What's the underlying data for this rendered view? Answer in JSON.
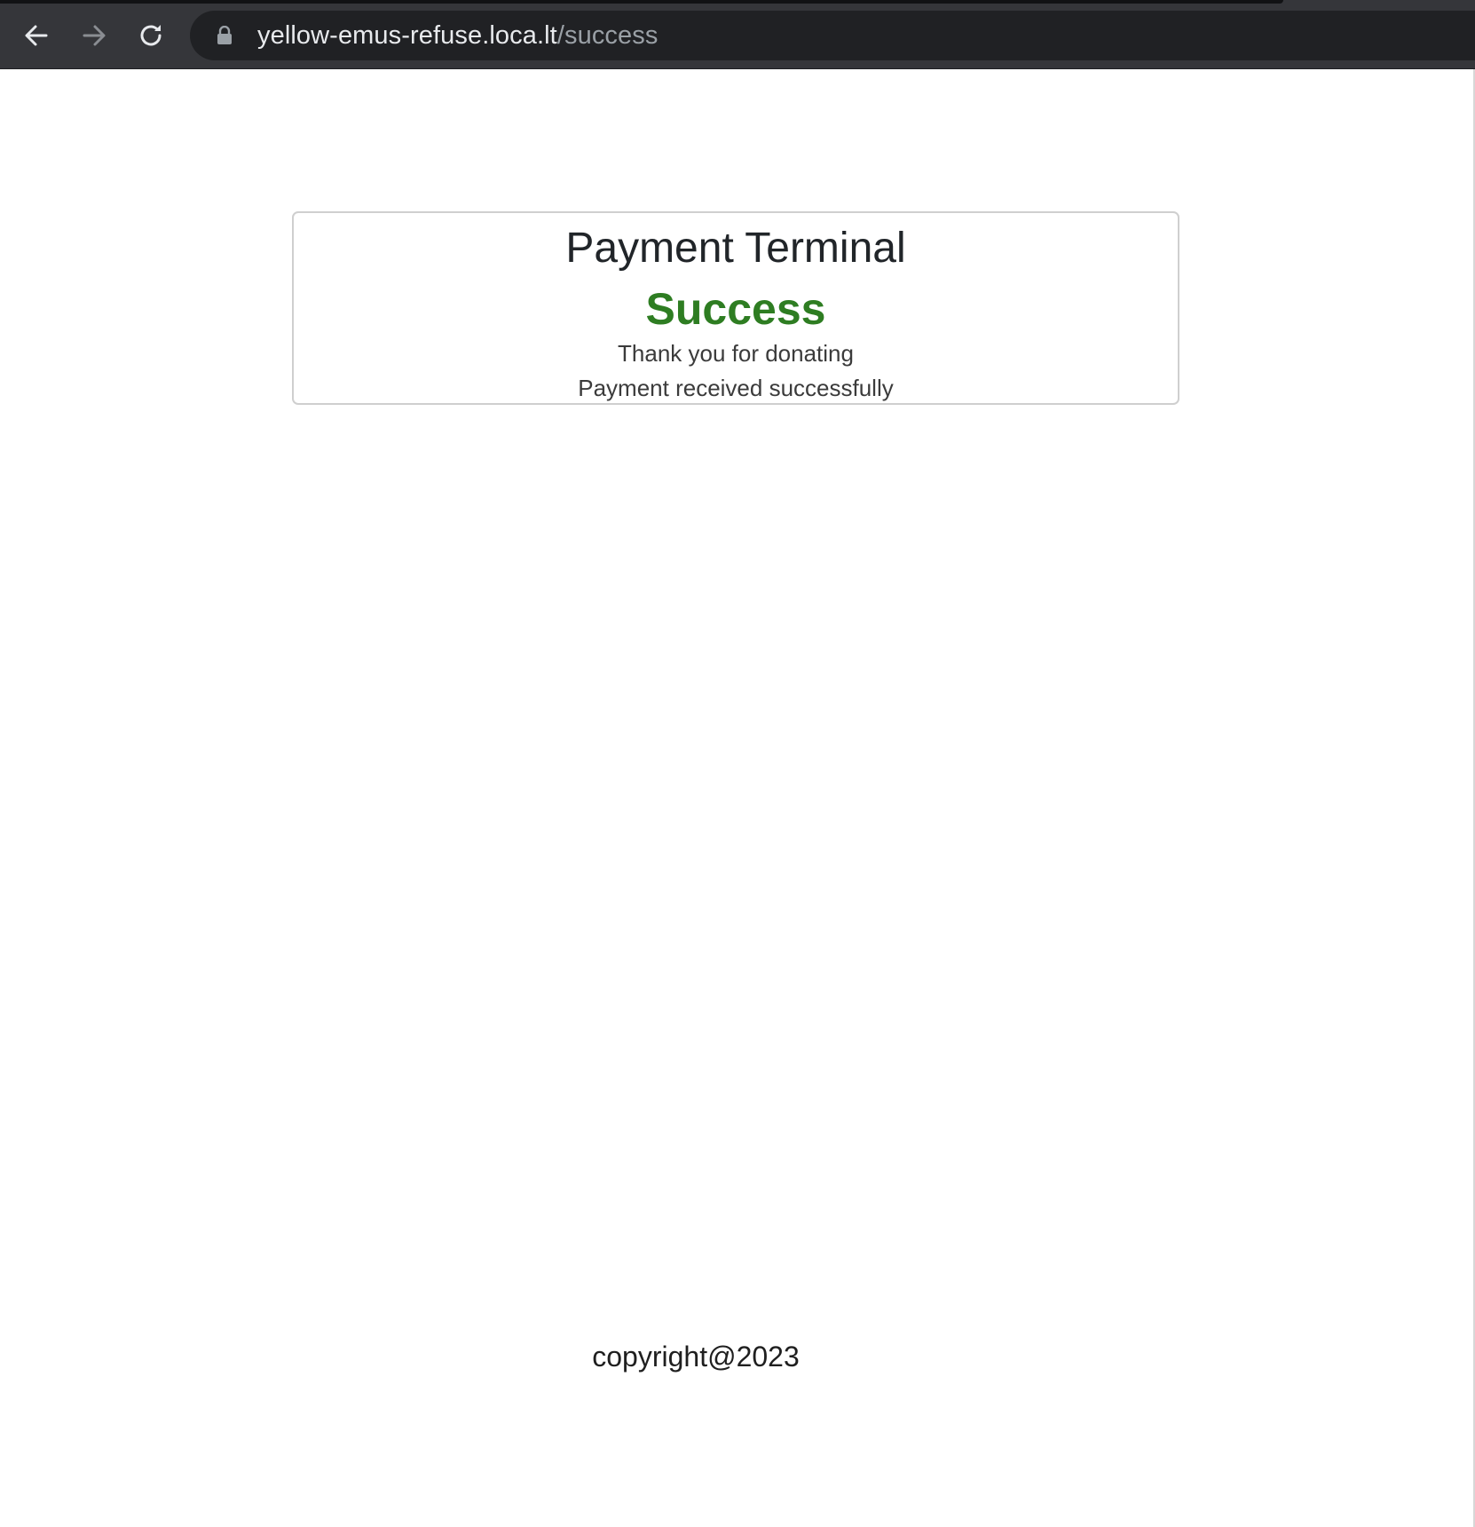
{
  "browser": {
    "url_host": "yellow-emus-refuse.loca.lt",
    "url_path": "/success",
    "icons": {
      "back": "back-arrow-icon",
      "forward": "forward-arrow-icon",
      "reload": "reload-icon",
      "lock": "lock-icon"
    }
  },
  "card": {
    "title": "Payment Terminal",
    "status": "Success",
    "status_color": "#2e7d22",
    "line1": "Thank you for donating",
    "line2": "Payment received successfully"
  },
  "footer": {
    "text": "copyright@2023"
  }
}
